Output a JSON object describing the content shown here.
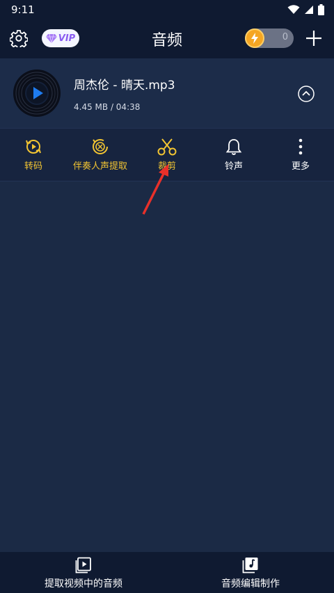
{
  "status_bar": {
    "time": "9:11"
  },
  "header": {
    "title": "音频",
    "vip_label": "VIP",
    "coin_count": "0"
  },
  "file": {
    "name": "周杰伦 - 晴天.mp3",
    "size": "4.45 MB",
    "separator": " / ",
    "duration": "04:38"
  },
  "actions": [
    {
      "label": "转码",
      "icon": "transcode-icon",
      "color": "#f3c532"
    },
    {
      "label": "伴奏人声提取",
      "icon": "vocal-extract-icon",
      "color": "#f3c532"
    },
    {
      "label": "裁剪",
      "icon": "scissors-icon",
      "color": "#f3c532"
    },
    {
      "label": "铃声",
      "icon": "bell-icon",
      "color": "#ffffff"
    },
    {
      "label": "更多",
      "icon": "more-vertical-icon",
      "color": "#ffffff"
    }
  ],
  "bottom_bar": {
    "extract_label": "提取视频中的音频",
    "edit_label": "音频编辑制作"
  },
  "colors": {
    "background": "#1b2a45",
    "bar": "#0f1a31",
    "accent_gold": "#f3c532",
    "play_blue": "#1e7cf0",
    "annotation_red": "#e8302a"
  }
}
